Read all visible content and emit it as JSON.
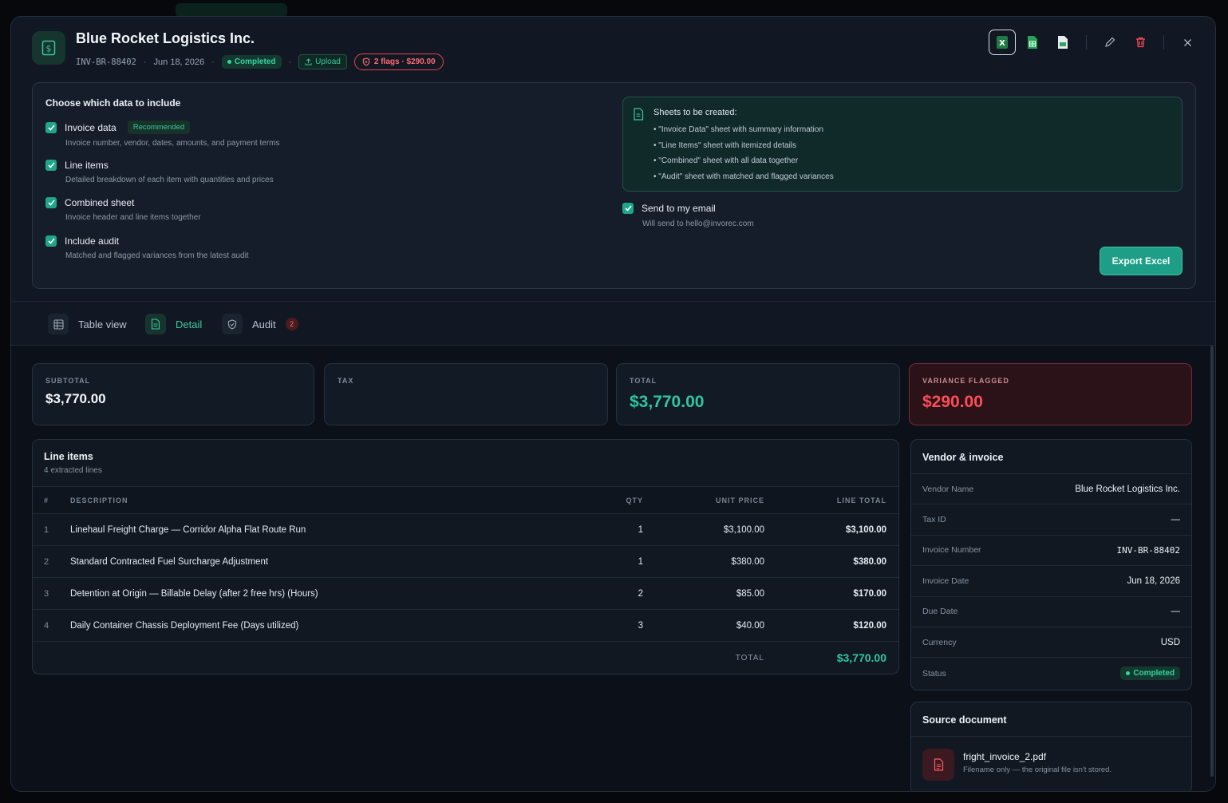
{
  "header": {
    "title": "Blue Rocket Logistics Inc.",
    "invoice_id": "INV-BR-88402",
    "date": "Jun 18, 2026",
    "status": "Completed",
    "source": "Upload",
    "flags": "2 flags · $290.00",
    "tools": [
      "excel-icon",
      "sheets-icon",
      "csv-icon",
      "pencil-icon",
      "trash-icon",
      "close-icon"
    ]
  },
  "export": {
    "heading": "Choose which data to include",
    "options": [
      {
        "label": "Invoice data",
        "tag": "Recommended",
        "desc": "Invoice number, vendor, dates, amounts, and payment terms"
      },
      {
        "label": "Line items",
        "desc": "Detailed breakdown of each item with quantities and prices"
      },
      {
        "label": "Combined sheet",
        "desc": "Invoice header and line items together"
      },
      {
        "label": "Include audit",
        "desc": "Matched and flagged variances from the latest audit"
      }
    ],
    "sheets_title": "Sheets to be created:",
    "sheets": [
      "• \"Invoice Data\" sheet with summary information",
      "• \"Line Items\" sheet with itemized details",
      "• \"Combined\" sheet with all data together",
      "• \"Audit\" sheet with matched and flagged variances"
    ],
    "email_label": "Send to my email",
    "email_desc": "Will send to hello@invorec.com",
    "button": "Export Excel"
  },
  "tabs": [
    {
      "label": "Table view"
    },
    {
      "label": "Detail"
    },
    {
      "label": "Audit",
      "badge": "2"
    }
  ],
  "stats": {
    "subtotal_label": "SUBTOTAL",
    "subtotal": "$3,770.00",
    "tax_label": "TAX",
    "tax": "",
    "total_label": "TOTAL",
    "total": "$3,770.00",
    "variance_label": "VARIANCE FLAGGED",
    "variance": "$290.00"
  },
  "line_items": {
    "title": "Line items",
    "subtitle": "4 extracted lines",
    "columns": [
      "#",
      "DESCRIPTION",
      "QTY",
      "UNIT PRICE",
      "LINE TOTAL"
    ],
    "rows": [
      {
        "n": "1",
        "desc": "Linehaul Freight Charge — Corridor Alpha Flat Route Run",
        "qty": "1",
        "unit": "$3,100.00",
        "total": "$3,100.00"
      },
      {
        "n": "2",
        "desc": "Standard Contracted Fuel Surcharge Adjustment",
        "qty": "1",
        "unit": "$380.00",
        "total": "$380.00"
      },
      {
        "n": "3",
        "desc": "Detention at Origin — Billable Delay (after 2 free hrs) (Hours)",
        "qty": "2",
        "unit": "$85.00",
        "total": "$170.00"
      },
      {
        "n": "4",
        "desc": "Daily Container Chassis Deployment Fee (Days utilized)",
        "qty": "3",
        "unit": "$40.00",
        "total": "$120.00"
      }
    ],
    "total_label": "TOTAL",
    "total": "$3,770.00"
  },
  "vendor": {
    "title": "Vendor & invoice",
    "rows": [
      {
        "k": "Vendor Name",
        "v": "Blue Rocket Logistics Inc."
      },
      {
        "k": "Tax ID",
        "v": "—"
      },
      {
        "k": "Invoice Number",
        "v": "INV-BR-88402"
      },
      {
        "k": "Invoice Date",
        "v": "Jun 18, 2026"
      },
      {
        "k": "Due Date",
        "v": "—"
      },
      {
        "k": "Currency",
        "v": "USD"
      },
      {
        "k": "Status",
        "v": "Completed"
      }
    ]
  },
  "source": {
    "title": "Source document",
    "filename": "fright_invoice_2.pdf",
    "note": "Filename only — the original file isn't stored."
  },
  "colors": {
    "accent": "#2ec79f",
    "danger": "#ff4d58",
    "bg": "#111823"
  }
}
